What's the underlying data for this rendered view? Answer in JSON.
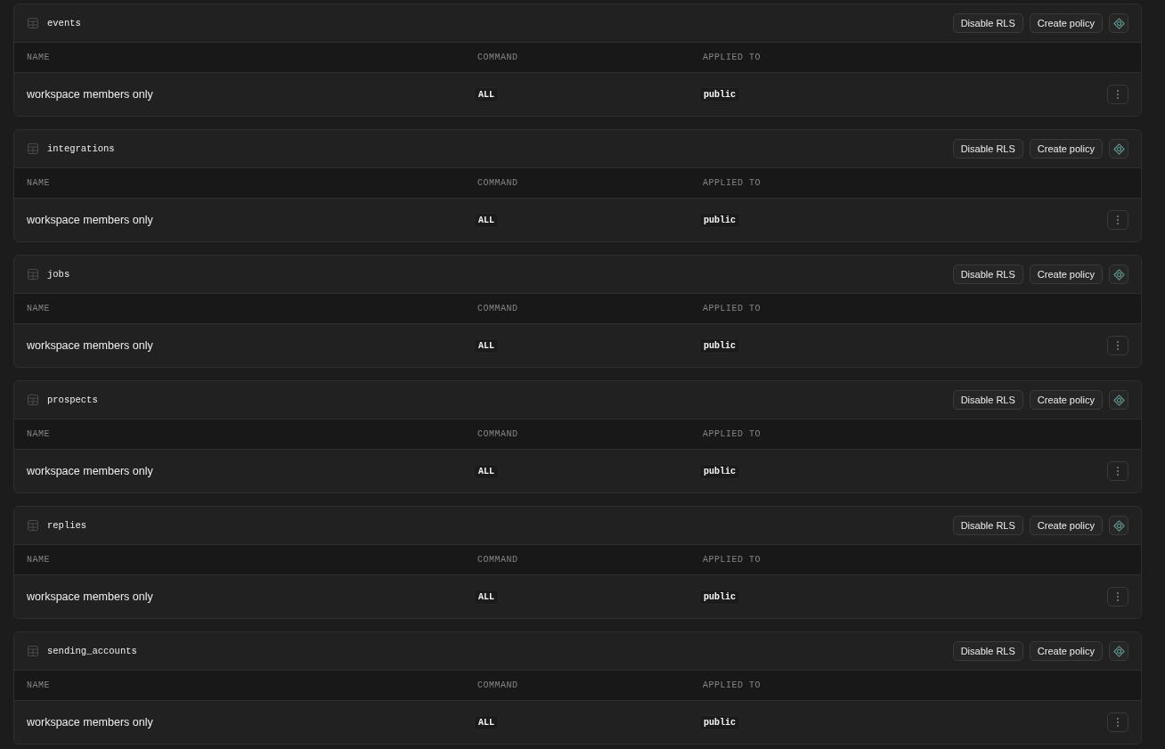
{
  "tables": [
    {
      "name": "events",
      "buttons": [
        "Disable RLS",
        "Create policy"
      ],
      "columns": [
        "NAME",
        "COMMAND",
        "APPLIED TO"
      ],
      "policies": [
        {
          "name": "workspace members only",
          "command": "ALL",
          "applied_to": "public"
        }
      ]
    },
    {
      "name": "integrations",
      "buttons": [
        "Disable RLS",
        "Create policy"
      ],
      "columns": [
        "NAME",
        "COMMAND",
        "APPLIED TO"
      ],
      "policies": [
        {
          "name": "workspace members only",
          "command": "ALL",
          "applied_to": "public"
        }
      ]
    },
    {
      "name": "jobs",
      "buttons": [
        "Disable RLS",
        "Create policy"
      ],
      "columns": [
        "NAME",
        "COMMAND",
        "APPLIED TO"
      ],
      "policies": [
        {
          "name": "workspace members only",
          "command": "ALL",
          "applied_to": "public"
        }
      ]
    },
    {
      "name": "prospects",
      "buttons": [
        "Disable RLS",
        "Create policy"
      ],
      "columns": [
        "NAME",
        "COMMAND",
        "APPLIED TO"
      ],
      "policies": [
        {
          "name": "workspace members only",
          "command": "ALL",
          "applied_to": "public"
        }
      ]
    },
    {
      "name": "replies",
      "buttons": [
        "Disable RLS",
        "Create policy"
      ],
      "columns": [
        "NAME",
        "COMMAND",
        "APPLIED TO"
      ],
      "policies": [
        {
          "name": "workspace members only",
          "command": "ALL",
          "applied_to": "public"
        }
      ]
    },
    {
      "name": "sending_accounts",
      "buttons": [
        "Disable RLS",
        "Create policy"
      ],
      "columns": [
        "NAME",
        "COMMAND",
        "APPLIED TO"
      ],
      "policies": [
        {
          "name": "workspace members only",
          "command": "ALL",
          "applied_to": "public"
        }
      ]
    }
  ]
}
